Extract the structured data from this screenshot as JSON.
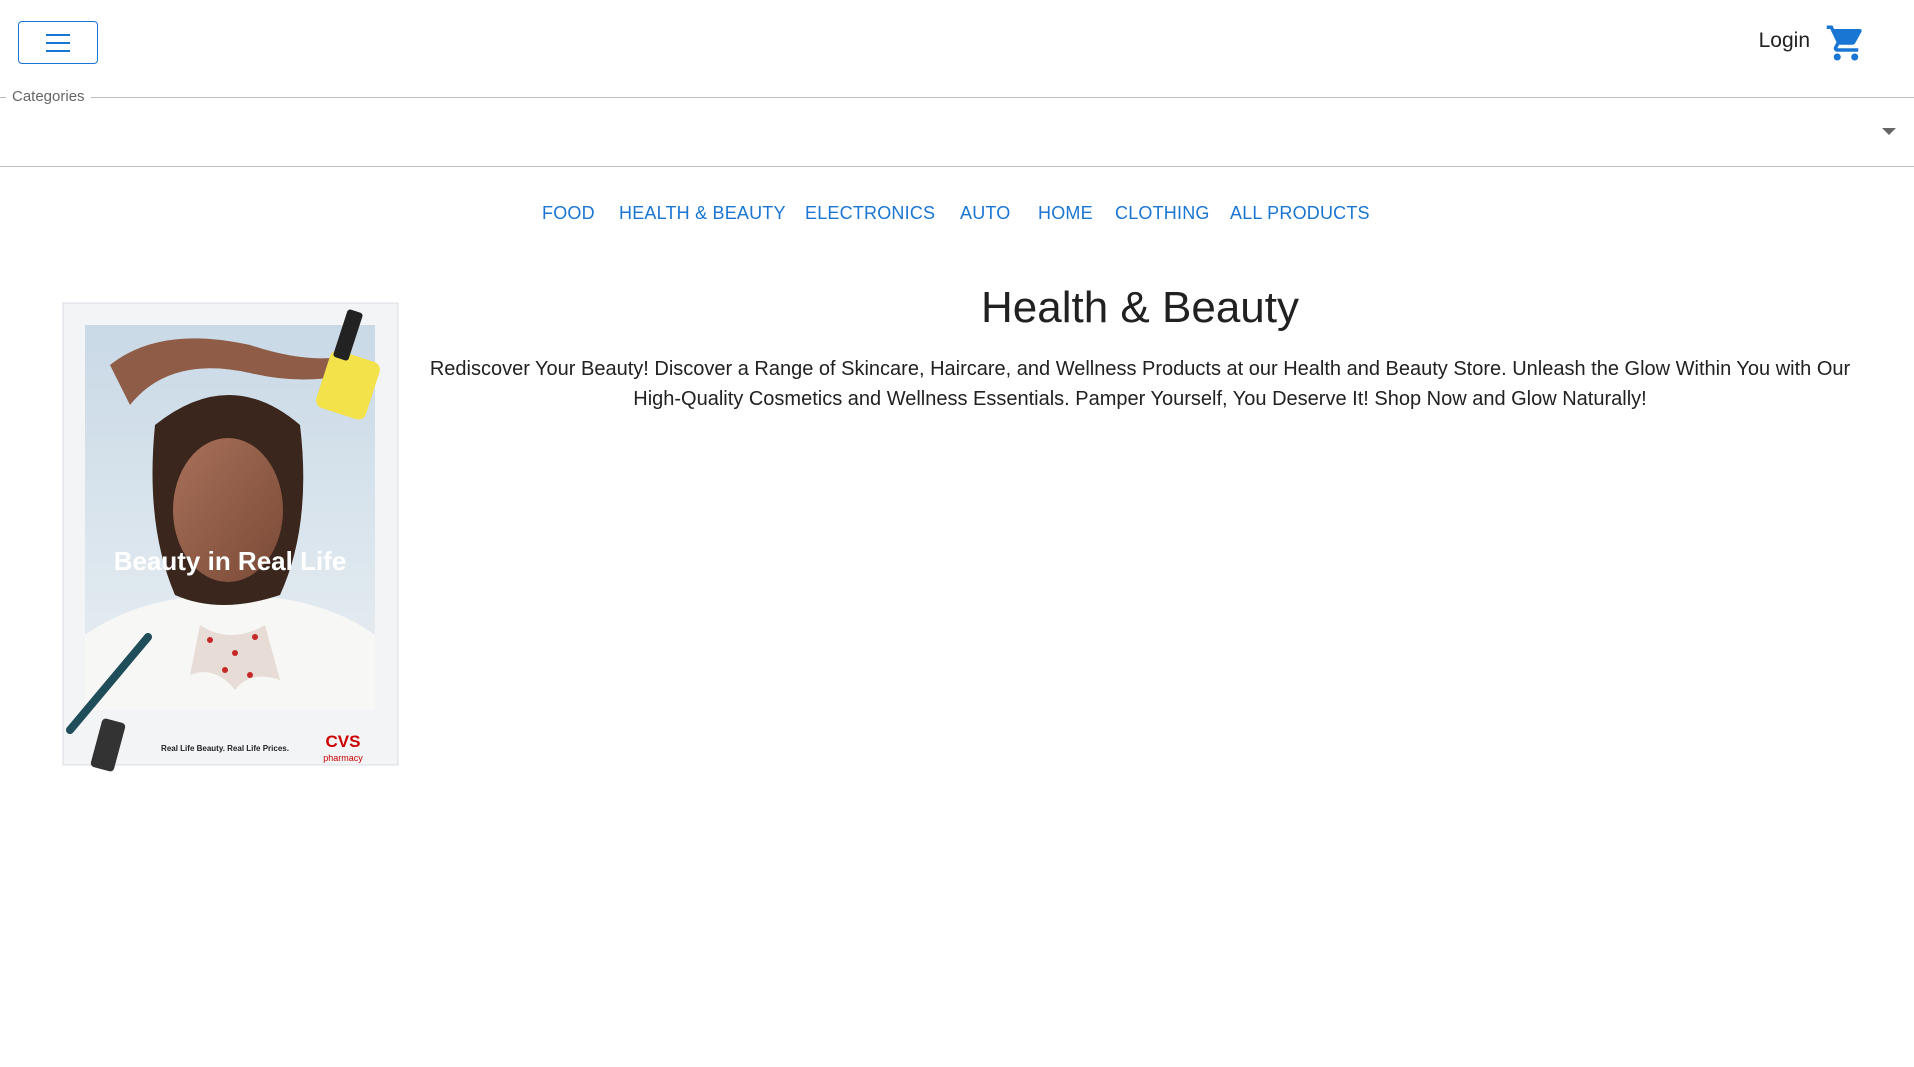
{
  "header": {
    "menu_icon": "hamburger-icon",
    "login_label": "Login",
    "cart_icon": "shopping-cart-icon",
    "accent_color": "#1976d2"
  },
  "categories": {
    "label": "Categories",
    "value": ""
  },
  "nav": {
    "items": [
      "FOOD",
      "HEALTH & BEAUTY",
      "ELECTRONICS",
      "AUTO",
      "HOME",
      "CLOTHING",
      "ALL PRODUCTS"
    ]
  },
  "main": {
    "title": "Health & Beauty",
    "description": "Rediscover Your Beauty! Discover a Range of Skincare, Haircare, and Wellness Products at our Health and Beauty Store. Unleash the Glow Within You with Our High-Quality Cosmetics and Wellness Essentials. Pamper Yourself, You Deserve It! Shop Now and Glow Naturally!"
  },
  "poster": {
    "headline": "Beauty in Real Life",
    "tagline": "Real Life Beauty. Real Life Prices.",
    "brand": "CVS",
    "brand_sub": "pharmacy"
  }
}
